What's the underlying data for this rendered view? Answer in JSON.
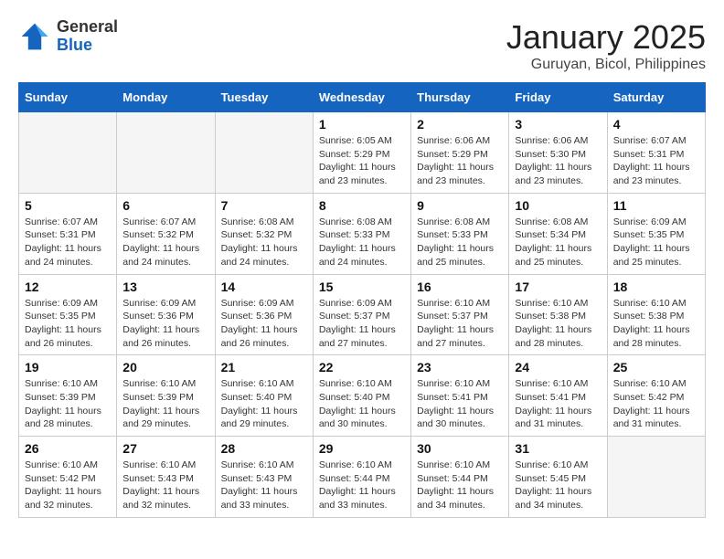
{
  "header": {
    "logo_line1": "General",
    "logo_line2": "Blue",
    "month": "January 2025",
    "location": "Guruyan, Bicol, Philippines"
  },
  "weekdays": [
    "Sunday",
    "Monday",
    "Tuesday",
    "Wednesday",
    "Thursday",
    "Friday",
    "Saturday"
  ],
  "weeks": [
    [
      {
        "day": "",
        "empty": true
      },
      {
        "day": "",
        "empty": true
      },
      {
        "day": "",
        "empty": true
      },
      {
        "day": "1",
        "sunrise": "6:05 AM",
        "sunset": "5:29 PM",
        "daylight": "11 hours and 23 minutes."
      },
      {
        "day": "2",
        "sunrise": "6:06 AM",
        "sunset": "5:29 PM",
        "daylight": "11 hours and 23 minutes."
      },
      {
        "day": "3",
        "sunrise": "6:06 AM",
        "sunset": "5:30 PM",
        "daylight": "11 hours and 23 minutes."
      },
      {
        "day": "4",
        "sunrise": "6:07 AM",
        "sunset": "5:31 PM",
        "daylight": "11 hours and 23 minutes."
      }
    ],
    [
      {
        "day": "5",
        "sunrise": "6:07 AM",
        "sunset": "5:31 PM",
        "daylight": "11 hours and 24 minutes."
      },
      {
        "day": "6",
        "sunrise": "6:07 AM",
        "sunset": "5:32 PM",
        "daylight": "11 hours and 24 minutes."
      },
      {
        "day": "7",
        "sunrise": "6:08 AM",
        "sunset": "5:32 PM",
        "daylight": "11 hours and 24 minutes."
      },
      {
        "day": "8",
        "sunrise": "6:08 AM",
        "sunset": "5:33 PM",
        "daylight": "11 hours and 24 minutes."
      },
      {
        "day": "9",
        "sunrise": "6:08 AM",
        "sunset": "5:33 PM",
        "daylight": "11 hours and 25 minutes."
      },
      {
        "day": "10",
        "sunrise": "6:08 AM",
        "sunset": "5:34 PM",
        "daylight": "11 hours and 25 minutes."
      },
      {
        "day": "11",
        "sunrise": "6:09 AM",
        "sunset": "5:35 PM",
        "daylight": "11 hours and 25 minutes."
      }
    ],
    [
      {
        "day": "12",
        "sunrise": "6:09 AM",
        "sunset": "5:35 PM",
        "daylight": "11 hours and 26 minutes."
      },
      {
        "day": "13",
        "sunrise": "6:09 AM",
        "sunset": "5:36 PM",
        "daylight": "11 hours and 26 minutes."
      },
      {
        "day": "14",
        "sunrise": "6:09 AM",
        "sunset": "5:36 PM",
        "daylight": "11 hours and 26 minutes."
      },
      {
        "day": "15",
        "sunrise": "6:09 AM",
        "sunset": "5:37 PM",
        "daylight": "11 hours and 27 minutes."
      },
      {
        "day": "16",
        "sunrise": "6:10 AM",
        "sunset": "5:37 PM",
        "daylight": "11 hours and 27 minutes."
      },
      {
        "day": "17",
        "sunrise": "6:10 AM",
        "sunset": "5:38 PM",
        "daylight": "11 hours and 28 minutes."
      },
      {
        "day": "18",
        "sunrise": "6:10 AM",
        "sunset": "5:38 PM",
        "daylight": "11 hours and 28 minutes."
      }
    ],
    [
      {
        "day": "19",
        "sunrise": "6:10 AM",
        "sunset": "5:39 PM",
        "daylight": "11 hours and 28 minutes."
      },
      {
        "day": "20",
        "sunrise": "6:10 AM",
        "sunset": "5:39 PM",
        "daylight": "11 hours and 29 minutes."
      },
      {
        "day": "21",
        "sunrise": "6:10 AM",
        "sunset": "5:40 PM",
        "daylight": "11 hours and 29 minutes."
      },
      {
        "day": "22",
        "sunrise": "6:10 AM",
        "sunset": "5:40 PM",
        "daylight": "11 hours and 30 minutes."
      },
      {
        "day": "23",
        "sunrise": "6:10 AM",
        "sunset": "5:41 PM",
        "daylight": "11 hours and 30 minutes."
      },
      {
        "day": "24",
        "sunrise": "6:10 AM",
        "sunset": "5:41 PM",
        "daylight": "11 hours and 31 minutes."
      },
      {
        "day": "25",
        "sunrise": "6:10 AM",
        "sunset": "5:42 PM",
        "daylight": "11 hours and 31 minutes."
      }
    ],
    [
      {
        "day": "26",
        "sunrise": "6:10 AM",
        "sunset": "5:42 PM",
        "daylight": "11 hours and 32 minutes."
      },
      {
        "day": "27",
        "sunrise": "6:10 AM",
        "sunset": "5:43 PM",
        "daylight": "11 hours and 32 minutes."
      },
      {
        "day": "28",
        "sunrise": "6:10 AM",
        "sunset": "5:43 PM",
        "daylight": "11 hours and 33 minutes."
      },
      {
        "day": "29",
        "sunrise": "6:10 AM",
        "sunset": "5:44 PM",
        "daylight": "11 hours and 33 minutes."
      },
      {
        "day": "30",
        "sunrise": "6:10 AM",
        "sunset": "5:44 PM",
        "daylight": "11 hours and 34 minutes."
      },
      {
        "day": "31",
        "sunrise": "6:10 AM",
        "sunset": "5:45 PM",
        "daylight": "11 hours and 34 minutes."
      },
      {
        "day": "",
        "empty": true
      }
    ]
  ],
  "labels": {
    "sunrise": "Sunrise:",
    "sunset": "Sunset:",
    "daylight": "Daylight:"
  }
}
